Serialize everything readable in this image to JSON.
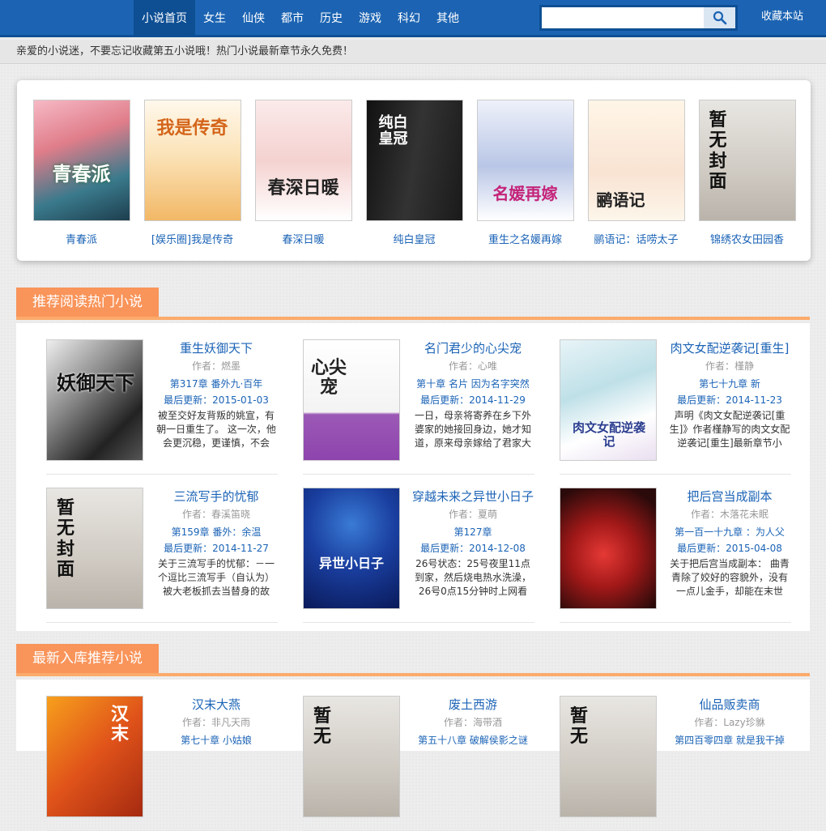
{
  "nav": {
    "items": [
      "小说首页",
      "女生",
      "仙侠",
      "都市",
      "历史",
      "游戏",
      "科幻",
      "其他"
    ],
    "search_placeholder": "",
    "favorite_label": "收藏本站"
  },
  "notice": "亲爱的小说迷，不要忘记收藏第五小说哦！热门小说最新章节永久免费！",
  "featured": [
    {
      "title": "青春派",
      "cover_text": "青春派"
    },
    {
      "title": "[娱乐圈]我是传奇",
      "cover_text": "我是传奇"
    },
    {
      "title": "春深日暖",
      "cover_text": "春深日暖"
    },
    {
      "title": "纯白皇冠",
      "cover_text": "纯白皇冠"
    },
    {
      "title": "重生之名媛再嫁",
      "cover_text": "名媛再嫁"
    },
    {
      "title": "鹂语记：话唠太子",
      "cover_text": "鹂语记"
    },
    {
      "title": "锦绣农女田园香",
      "cover_text": "暂无封面"
    }
  ],
  "sections": [
    {
      "title": "推荐阅读热门小说",
      "books": [
        {
          "title": "重生妖御天下",
          "author": "作者：燃墨",
          "chapter": "第317章 番外九·百年",
          "update": "最后更新：2015-01-03",
          "desc": "被至交好友背叛的姚宣，有朝一日重生了。 这一次，他会更沉稳，更谨慎，不会",
          "cover_text": "妖御天下"
        },
        {
          "title": "名门君少的心尖宠",
          "author": "作者：心唯",
          "chapter": "第十章 名片 因为名字突然",
          "update": "最后更新：2014-11-29",
          "desc": "一日，母亲将寄养在乡下外婆家的她接回身边，她才知道，原来母亲嫁给了君家大",
          "cover_text": "心尖宠"
        },
        {
          "title": "肉文女配逆袭记[重生]",
          "author": "作者：槿静",
          "chapter": "第七十九章 新",
          "update": "最后更新：2014-11-23",
          "desc": "声明《肉文女配逆袭记[重生]》作者槿静写的肉文女配逆袭记[重生]最新章节小",
          "cover_text": "肉文女配逆袭记"
        },
        {
          "title": "三流写手的忧郁",
          "author": "作者：春溪笛晓",
          "chapter": "第159章 番外：余温",
          "update": "最后更新：2014-11-27",
          "desc": "关于三流写手的忧郁：－一个逗比三流写手（自认为）被大老板抓去当替身的故",
          "cover_text": "暂无封面"
        },
        {
          "title": "穿越未来之异世小日子",
          "author": "作者：夏萌",
          "chapter": "第127章",
          "update": "最后更新：2014-12-08",
          "desc": "26号状态：25号夜里11点到家，然后烧电热水洗澡，26号0点15分钟时上网看",
          "cover_text": "异世小日子"
        },
        {
          "title": "把后宫当成副本",
          "author": "作者：木落花未眠",
          "chapter": "第一百一十九章 ：为人父",
          "update": "最后更新：2015-04-08",
          "desc": "关于把后宫当成副本： 曲青青除了姣好的容貌外，没有一点儿金手，却能在末世",
          "cover_text": ""
        }
      ]
    },
    {
      "title": "最新入库推荐小说",
      "books": [
        {
          "title": "汉末大燕",
          "author": "作者：非凡天雨",
          "chapter": "第七十章 小姑娘",
          "update": "",
          "desc": "",
          "cover_text": "汉末"
        },
        {
          "title": "废土西游",
          "author": "作者：海带酒",
          "chapter": "第五十八章 破解侯影之谜",
          "update": "",
          "desc": "",
          "cover_text": "暂无"
        },
        {
          "title": "仙品贩卖商",
          "author": "作者：Lazy珍貅",
          "chapter": "第四百零四章 就是我干掉",
          "update": "",
          "desc": "",
          "cover_text": "暂无"
        }
      ]
    }
  ],
  "colors": {
    "nav_bg": "#1c64b3",
    "nav_active": "#0e4f94",
    "link": "#1b63b6",
    "section_tab": "#f9945a",
    "section_line": "#fbab6b"
  }
}
